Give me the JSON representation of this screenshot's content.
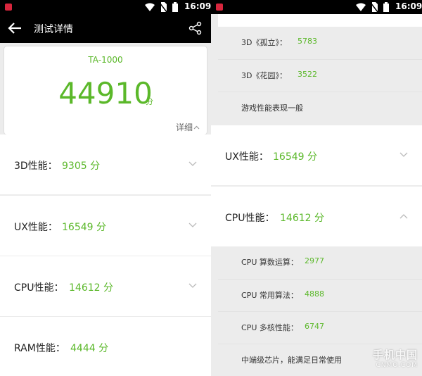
{
  "colors": {
    "accent": "#5bb82a",
    "bar": "#000000",
    "bg": "#ececec"
  },
  "status": {
    "time": "16:09"
  },
  "appbar": {
    "title": "测试详情",
    "back_icon": "back-arrow-icon",
    "share_icon": "share-icon"
  },
  "score_card": {
    "device": "TA-1000",
    "score": "44910",
    "unit": "分",
    "detail_label": "详细"
  },
  "left_rows": [
    {
      "label": "3D性能：",
      "value": "9305 分"
    },
    {
      "label": "UX性能：",
      "value": "16549 分"
    },
    {
      "label": "CPU性能：",
      "value": "14612 分"
    },
    {
      "label": "RAM性能：",
      "value": "4444 分"
    }
  ],
  "right_top_subs": [
    {
      "label": "3D《孤立》：",
      "value": "5783"
    },
    {
      "label": "3D《花园》：",
      "value": "3522"
    },
    {
      "label": "游戏性能表现一般",
      "value": ""
    }
  ],
  "right_rows": [
    {
      "label": "UX性能：",
      "value": "16549 分"
    },
    {
      "label": "CPU性能：",
      "value": "14612 分"
    }
  ],
  "right_cpu_subs": [
    {
      "label": "CPU 算数运算：",
      "value": "2977"
    },
    {
      "label": "CPU 常用算法：",
      "value": "4888"
    },
    {
      "label": "CPU 多核性能：",
      "value": "6747"
    },
    {
      "label": "中端级芯片，能满足日常使用",
      "value": ""
    }
  ],
  "watermark": {
    "text": "手机中国",
    "sub": "CNMO.COM"
  }
}
